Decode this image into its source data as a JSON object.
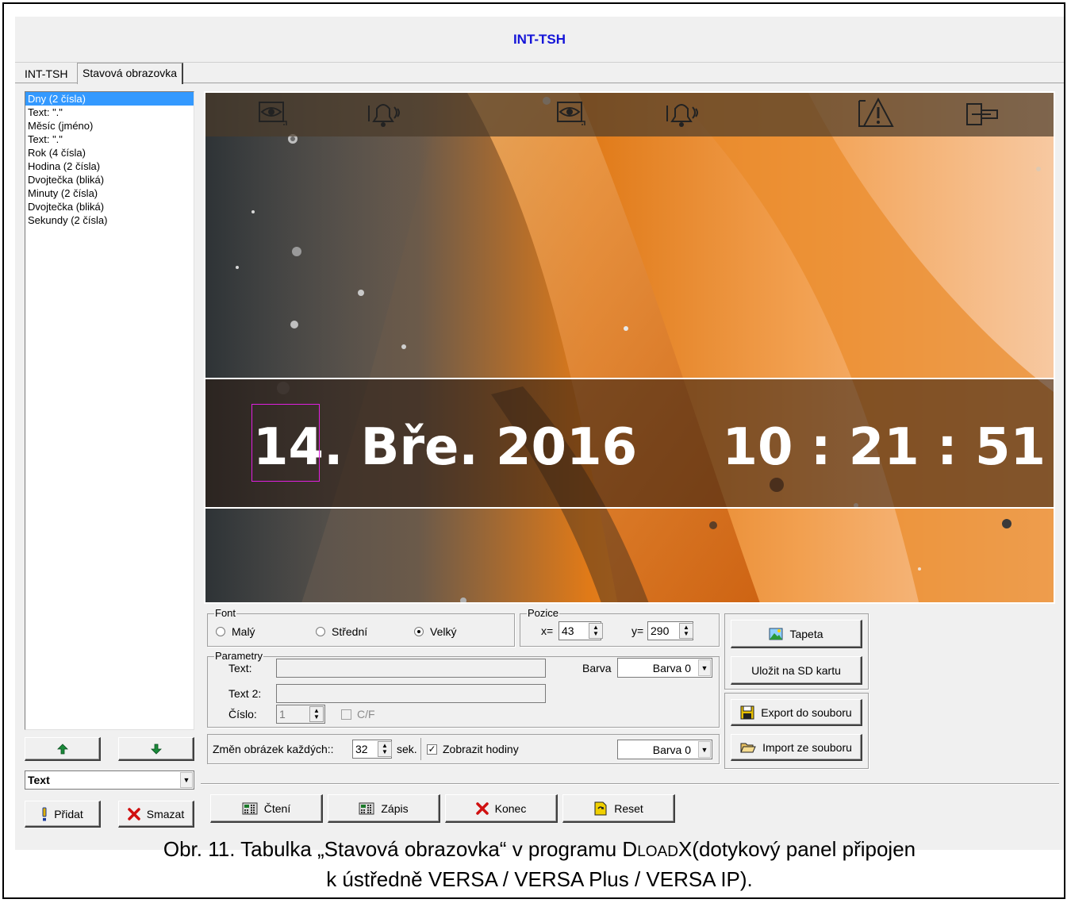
{
  "window": {
    "title": "INT-TSH"
  },
  "tabs": [
    "INT-TSH",
    "Stavová obrazovka"
  ],
  "element_list": [
    "Dny (2 čísla)",
    "Text: \".\"",
    "Měsíc (jméno)",
    "Text: \".\"",
    "Rok (4 čísla)",
    "Hodina (2 čísla)",
    "Dvojtečka (bliká)",
    "Minuty (2 čísla)",
    "Dvojtečka (bliká)",
    "Sekundy (2 čísla)"
  ],
  "element_type": {
    "value": "Text"
  },
  "left_buttons": {
    "add": "Přidat",
    "delete": "Smazat"
  },
  "preview": {
    "date_day": "14",
    "date_rest": ". Bře. 2016",
    "time": "10 : 21 : 51",
    "icons": [
      "eye-icon",
      "bell-icon",
      "eye-icon",
      "bell-icon",
      "warning-icon",
      "plug-icon"
    ]
  },
  "font_group": {
    "label": "Font",
    "options": [
      "Malý",
      "Střední",
      "Velký"
    ],
    "selected": "Velký"
  },
  "position_group": {
    "label": "Pozice",
    "x_label": "x=",
    "x": "43",
    "y_label": "y=",
    "y": "290"
  },
  "params_group": {
    "label": "Parametry",
    "text_label": "Text:",
    "text2_label": "Text 2:",
    "number_label": "Číslo:",
    "number": "1",
    "cf_label": "C/F",
    "color_label": "Barva",
    "color_value": "Barva 0"
  },
  "slideshow": {
    "label": "Změn obrázek každých::",
    "seconds": "32",
    "unit": "sek.",
    "show_clock_label": "Zobrazit hodiny",
    "show_clock_checked": true,
    "color_value": "Barva 0"
  },
  "side_buttons": {
    "wallpaper": "Tapeta",
    "save_sd": "Uložit na SD kartu",
    "export": "Export do souboru",
    "import": "Import ze souboru"
  },
  "bottom_buttons": {
    "read": "Čtení",
    "write": "Zápis",
    "end": "Konec",
    "reset": "Reset"
  },
  "caption": {
    "prefix": "Obr. 11. Tabulka „Stavová obrazovka“ v programu D",
    "smallcaps": "LOAD",
    "suffix": "X(dotykový panel připojen",
    "line2": "k ústředně VERSA / VERSA Plus / VERSA IP)."
  },
  "colors": {
    "title": "#1414d8",
    "selection": "#3399ff",
    "highlight_box": "#e020e0"
  }
}
